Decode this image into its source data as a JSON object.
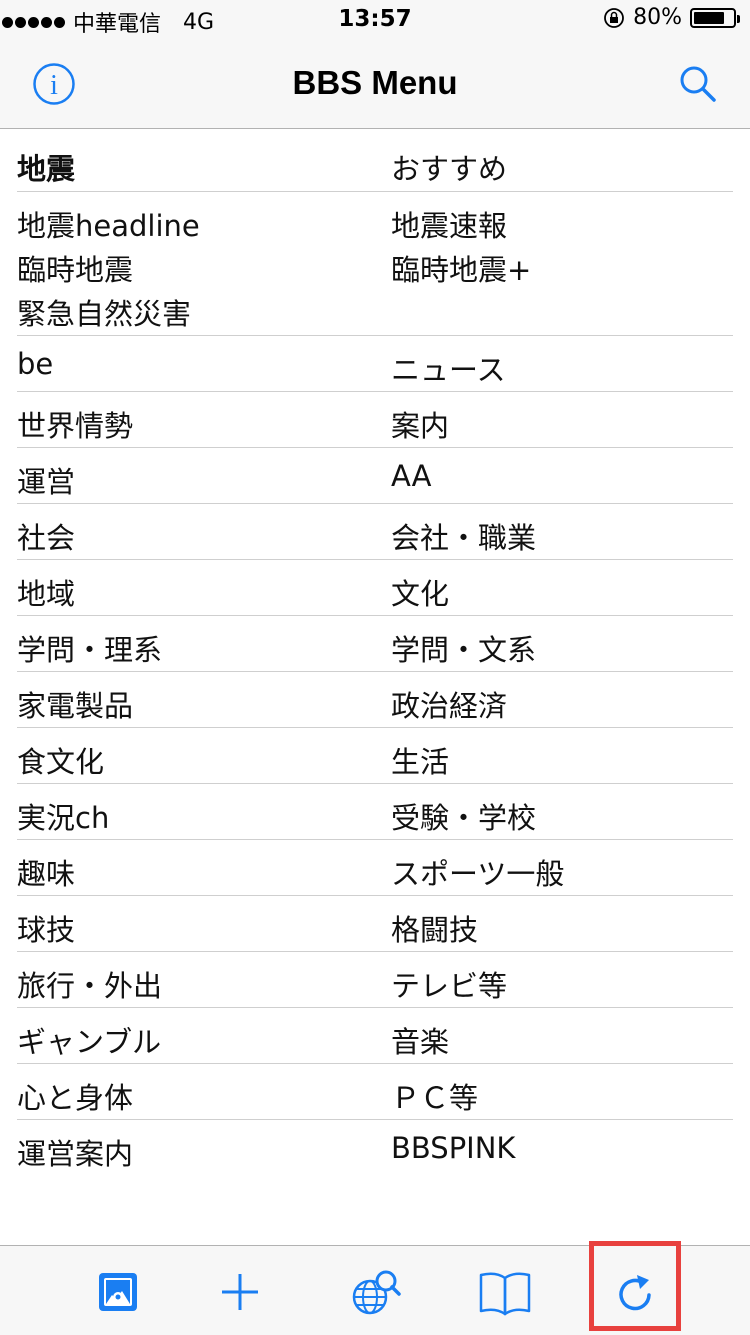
{
  "status_bar": {
    "carrier": "中華電信",
    "network": "4G",
    "time": "13:57",
    "battery": "80%",
    "battery_level": 0.8
  },
  "nav": {
    "title": "BBS Menu",
    "left_icon": "info-icon",
    "right_icon": "search-icon"
  },
  "list": {
    "header": {
      "left": "地震",
      "right": "おすすめ"
    },
    "multi": {
      "left": [
        "地震headline",
        "臨時地震",
        "緊急自然災害"
      ],
      "right": [
        "地震速報",
        "臨時地震+"
      ]
    },
    "rows": [
      {
        "left": "be",
        "right": "ニュース"
      },
      {
        "left": "世界情勢",
        "right": "案内"
      },
      {
        "left": "運営",
        "right": "AA"
      },
      {
        "left": "社会",
        "right": "会社・職業"
      },
      {
        "left": "地域",
        "right": "文化"
      },
      {
        "left": "学問・理系",
        "right": "学問・文系"
      },
      {
        "left": "家電製品",
        "right": "政治経済"
      },
      {
        "left": "食文化",
        "right": "生活"
      },
      {
        "left": "実況ch",
        "right": "受験・学校"
      },
      {
        "left": "趣味",
        "right": "スポーツ一般"
      },
      {
        "left": "球技",
        "right": "格闘技"
      },
      {
        "left": "旅行・外出",
        "right": "テレビ等"
      },
      {
        "left": "ギャンブル",
        "right": "音楽"
      },
      {
        "left": "心と身体",
        "right": "ＰＣ等"
      },
      {
        "left": "運営案内",
        "right": "BBSPINK"
      }
    ]
  },
  "tab_bar": {
    "icons": [
      "gallery-icon",
      "add-icon",
      "globe-search-icon",
      "bookmarks-book-icon",
      "refresh-icon"
    ],
    "accent_color": "#1a7ef2",
    "highlight_color": "#e8413e"
  }
}
